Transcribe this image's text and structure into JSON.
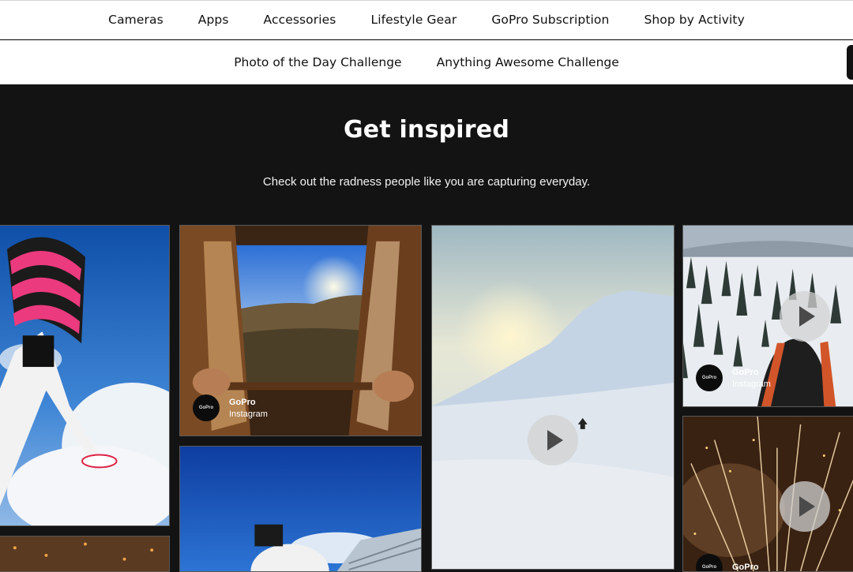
{
  "nav": {
    "items": [
      "Cameras",
      "Apps",
      "Accessories",
      "Lifestyle Gear",
      "GoPro Subscription",
      "Shop by Activity"
    ]
  },
  "subnav": {
    "items": [
      "Photo of the Day Challenge",
      "Anything Awesome Challenge"
    ]
  },
  "hero": {
    "title": "Get inspired",
    "subtitle": "Check out the radness people like you are capturing everyday."
  },
  "gallery": {
    "logo_text": "GoPro",
    "tiles": [
      {
        "name": "skydiver",
        "author": "",
        "source": ""
      },
      {
        "name": "window-sunset",
        "author": "GoPro",
        "source": "Instagram"
      },
      {
        "name": "snow-sun-video",
        "author": "",
        "source": ""
      },
      {
        "name": "ski-forest-video",
        "author": "GoPro",
        "source": "Instagram"
      },
      {
        "name": "blue-sky-helmet",
        "author": "",
        "source": ""
      },
      {
        "name": "fireworks-video",
        "author": "GoPro",
        "source": ""
      },
      {
        "name": "sparks",
        "author": "",
        "source": ""
      }
    ]
  },
  "colors": {
    "background": "#131313",
    "nav_bg": "#ffffff",
    "text": "#111111"
  }
}
